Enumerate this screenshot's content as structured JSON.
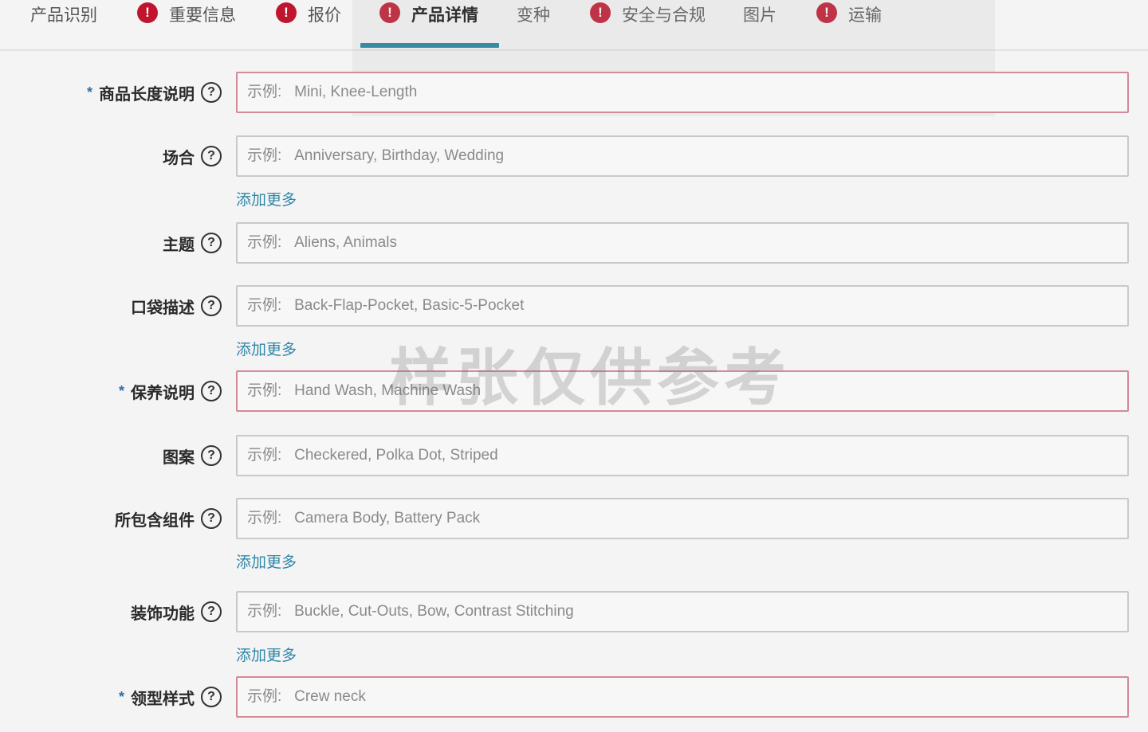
{
  "tabs": [
    {
      "label": "产品识别",
      "alert": false
    },
    {
      "label": "重要信息",
      "alert": true
    },
    {
      "label": "报价",
      "alert": true
    },
    {
      "label": "产品详情",
      "alert": true,
      "active": true
    },
    {
      "label": "变种",
      "alert": false
    },
    {
      "label": "安全与合规",
      "alert": true
    },
    {
      "label": "图片",
      "alert": false
    },
    {
      "label": "运输",
      "alert": true
    }
  ],
  "alert_glyph": "!",
  "help_glyph": "?",
  "required_mark": "*",
  "add_more_label": "添加更多",
  "fields": [
    {
      "label": "商品长度说明",
      "required": true,
      "placeholder": "示例:   Mini, Knee-Length"
    },
    {
      "label": "场合",
      "required": false,
      "placeholder": "示例:   Anniversary, Birthday, Wedding",
      "add_more": true
    },
    {
      "label": "主题",
      "required": false,
      "placeholder": "示例:   Aliens, Animals"
    },
    {
      "label": "口袋描述",
      "required": false,
      "placeholder": "示例:   Back-Flap-Pocket, Basic-5-Pocket",
      "add_more": true
    },
    {
      "label": "保养说明",
      "required": true,
      "placeholder": "示例:   Hand Wash, Machine Wash"
    },
    {
      "label": "图案",
      "required": false,
      "placeholder": "示例:   Checkered, Polka Dot, Striped"
    },
    {
      "label": "所包含组件",
      "required": false,
      "placeholder": "示例:   Camera Body, Battery Pack",
      "add_more": true
    },
    {
      "label": "装饰功能",
      "required": false,
      "placeholder": "示例:   Buckle, Cut-Outs, Bow, Contrast Stitching",
      "add_more": true
    },
    {
      "label": "领型样式",
      "required": true,
      "placeholder": "示例:   Crew neck"
    }
  ],
  "watermark": "样张仅供参考",
  "colors": {
    "accent": "#1d7f9e",
    "alert": "#c0152e",
    "link": "#2f87a8",
    "required_border": "#d38a99"
  }
}
